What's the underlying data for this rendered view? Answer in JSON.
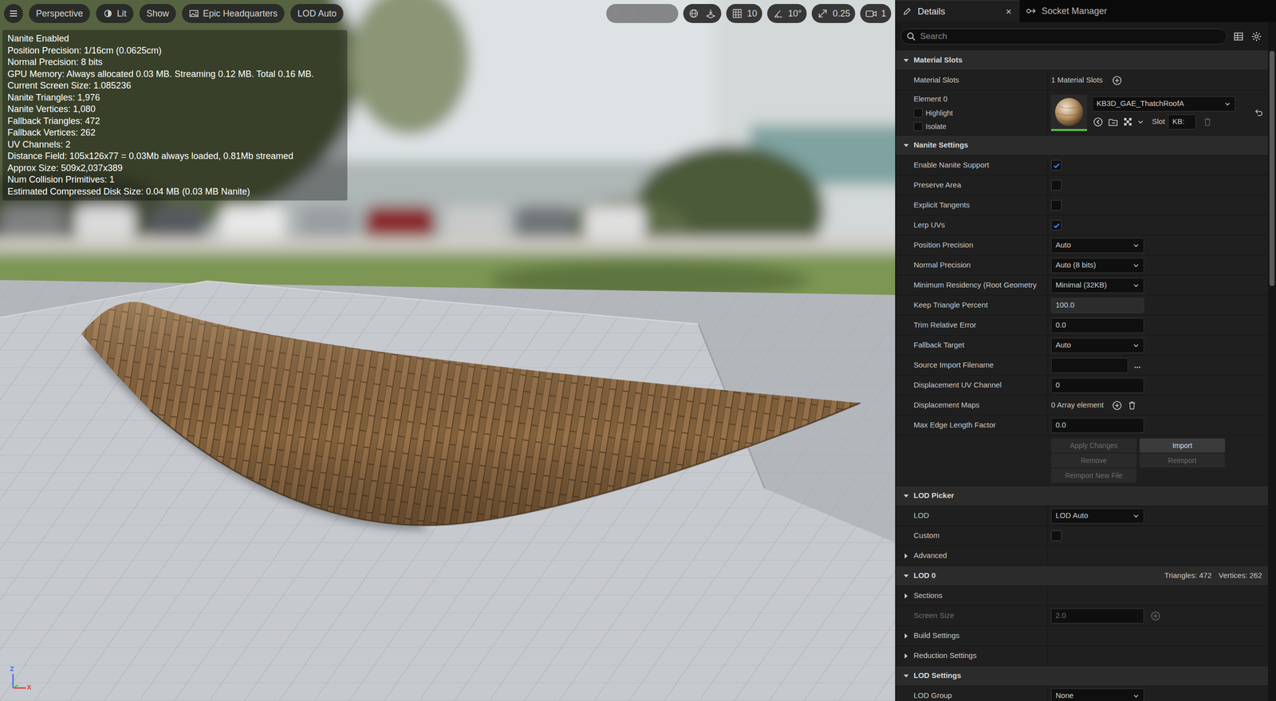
{
  "viewport": {
    "toolbar": {
      "left": [
        {
          "label": "Perspective"
        },
        {
          "label": "Lit"
        },
        {
          "label": "Show"
        },
        {
          "label": "Epic Headquarters"
        },
        {
          "label": "LOD Auto"
        }
      ],
      "right": [
        {
          "label": "10"
        },
        {
          "label": "10°"
        },
        {
          "label": "0.25"
        },
        {
          "label": "1"
        }
      ]
    },
    "stats": [
      "Nanite Enabled",
      "Position Precision: 1/16cm (0.0625cm)",
      "Normal Precision: 8 bits",
      "GPU Memory: Always allocated 0.03 MB. Streaming 0.12 MB. Total 0.16 MB.",
      "Current Screen Size:  1.085236",
      "Nanite Triangles:  1,976",
      "Nanite Vertices:  1,080",
      "Fallback Triangles:  472",
      "Fallback Vertices:  262",
      "UV Channels:  2",
      "Distance Field:  105x126x77 = 0.03Mb always loaded, 0.81Mb streamed",
      "Approx Size: 509x2,037x389",
      "Num Collision Primitives:  1",
      "Estimated Compressed Disk Size: 0.04 MB (0.03 MB Nanite)"
    ],
    "gizmo": {
      "z": "Z",
      "x": "X"
    }
  },
  "details": {
    "tabs": [
      {
        "label": "Details",
        "selected": true,
        "close": "×"
      },
      {
        "label": "Socket Manager",
        "selected": false
      }
    ],
    "search": {
      "placeholder": "Search"
    },
    "sections": [
      {
        "title": "Material Slots",
        "expanded": true,
        "rows": [
          {
            "kind": "count",
            "label": "Material Slots",
            "value": "1 Material Slots"
          },
          {
            "kind": "material",
            "label": "Element 0",
            "options": [
              {
                "label": "Highlight",
                "checked": false
              },
              {
                "label": "Isolate",
                "checked": false
              }
            ],
            "material": "KB3D_GAE_ThatchRoofA",
            "slot_label": "Slot",
            "slot": "KB:"
          }
        ]
      },
      {
        "title": "Nanite Settings",
        "expanded": true,
        "rows": [
          {
            "kind": "checkbox",
            "label": "Enable Nanite Support",
            "checked": true
          },
          {
            "kind": "checkbox",
            "label": "Preserve Area",
            "checked": false
          },
          {
            "kind": "checkbox",
            "label": "Explicit Tangents",
            "checked": false
          },
          {
            "kind": "checkbox",
            "label": "Lerp UVs",
            "checked": true
          },
          {
            "kind": "dropdown",
            "label": "Position Precision",
            "value": "Auto"
          },
          {
            "kind": "dropdown",
            "label": "Normal Precision",
            "value": "Auto (8 bits)"
          },
          {
            "kind": "dropdown",
            "label": "Minimum Residency (Root Geometry",
            "value": "Minimal (32KB)"
          },
          {
            "kind": "spin",
            "label": "Keep Triangle Percent",
            "value": "100.0"
          },
          {
            "kind": "input",
            "label": "Trim Relative Error",
            "value": "0.0"
          },
          {
            "kind": "dropdown",
            "label": "Fallback Target",
            "value": "Auto"
          },
          {
            "kind": "file",
            "label": "Source Import Filename",
            "value": "",
            "browse": "..."
          },
          {
            "kind": "input",
            "label": "Displacement UV Channel",
            "value": "0"
          },
          {
            "kind": "array",
            "label": "Displacement Maps",
            "value": "0 Array element"
          },
          {
            "kind": "input",
            "label": "Max Edge Length Factor",
            "value": "0.0"
          },
          {
            "kind": "buttons",
            "buttons": [
              {
                "label": "Apply Changes",
                "disabled": true
              },
              {
                "label": "Import",
                "disabled": false
              },
              {
                "label": "Remove",
                "disabled": true
              },
              {
                "label": "Reimport",
                "disabled": true
              },
              {
                "label": "Reimport New File",
                "disabled": true
              }
            ]
          }
        ]
      },
      {
        "title": "LOD Picker",
        "expanded": true,
        "rows": [
          {
            "kind": "dropdown",
            "label": "LOD",
            "value": "LOD Auto"
          },
          {
            "kind": "checkbox",
            "label": "Custom",
            "checked": false
          },
          {
            "kind": "group",
            "label": "Advanced",
            "expanded": false
          }
        ]
      },
      {
        "title": "LOD 0",
        "expanded": true,
        "summary": [
          "Triangles: 472",
          "Vertices: 262"
        ],
        "rows": [
          {
            "kind": "group",
            "label": "Sections",
            "expanded": false
          },
          {
            "kind": "input",
            "label": "Screen Size",
            "value": "2.0",
            "disabled": true
          },
          {
            "kind": "group",
            "label": "Build Settings",
            "expanded": false
          },
          {
            "kind": "group",
            "label": "Reduction Settings",
            "expanded": false
          }
        ]
      },
      {
        "title": "LOD Settings",
        "expanded": true,
        "rows": [
          {
            "kind": "dropdown",
            "label": "LOD Group",
            "value": "None"
          }
        ]
      }
    ]
  }
}
